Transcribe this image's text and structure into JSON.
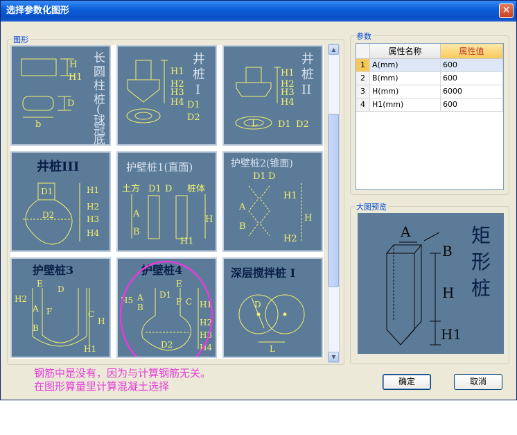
{
  "window": {
    "title": "选择参数化图形",
    "close": "✕"
  },
  "shapes_group": {
    "label": "图形"
  },
  "tiles": [
    {
      "name": "长圆柱桩(球冠底)",
      "lines": [
        "长",
        "圆",
        "柱",
        "桩",
        "(",
        "球",
        "冠",
        "底",
        ")"
      ],
      "labels": [
        "H",
        "H1",
        "D",
        "b"
      ]
    },
    {
      "name": "井桩I",
      "lines": [
        "井",
        "桩",
        "I"
      ],
      "labels": [
        "H1",
        "H2",
        "H3",
        "H4",
        "D1",
        "D2"
      ]
    },
    {
      "name": "井桩II",
      "lines": [
        "井",
        "桩",
        "II"
      ],
      "labels": [
        "H1",
        "H2",
        "H3",
        "H4",
        "L",
        "D1",
        "D2"
      ]
    },
    {
      "name": "井桩III",
      "title": "井桩III",
      "labels": [
        "D1",
        "D2",
        "H1",
        "H2",
        "H3",
        "H4"
      ]
    },
    {
      "name": "护壁桩1(直面)",
      "title": "护壁桩1(直面)",
      "labels": [
        "土方",
        "D1",
        "D",
        "桩体",
        "A",
        "B",
        "H",
        "H1"
      ]
    },
    {
      "name": "护壁桩2(锥面)",
      "title": "护壁桩2(锥面)",
      "labels": [
        "D1",
        "D",
        "A",
        "B",
        "H1",
        "H",
        "H2"
      ]
    },
    {
      "name": "护壁桩3",
      "title": "护壁桩3",
      "labels": [
        "E",
        "D",
        "H2",
        "A",
        "F",
        "B",
        "C",
        "H",
        "H1"
      ]
    },
    {
      "name": "护壁桩4",
      "title": "护壁桩4",
      "labels": [
        "E",
        "H5",
        "D1",
        "A",
        "B",
        "F",
        "C",
        "H1",
        "H2",
        "H3",
        "D2",
        "H4"
      ]
    },
    {
      "name": "深层搅拌桩 I",
      "title": "深层搅拌桩 I",
      "labels": [
        "D",
        "L"
      ]
    }
  ],
  "annotation": {
    "line1": "钢筋中是没有，因为与计算钢筋无关。",
    "line2": "在图形算量里计算混凝土选择"
  },
  "params_group": {
    "label": "参数"
  },
  "table": {
    "headers": [
      "属性名称",
      "属性值"
    ],
    "rows": [
      {
        "idx": "1",
        "name": "A(mm)",
        "value": "600"
      },
      {
        "idx": "2",
        "name": "B(mm)",
        "value": "600"
      },
      {
        "idx": "3",
        "name": "H(mm)",
        "value": "6000"
      },
      {
        "idx": "4",
        "name": "H1(mm)",
        "value": "600"
      }
    ]
  },
  "preview_group": {
    "label": "大图预览"
  },
  "preview": {
    "lines": [
      "矩",
      "形",
      "桩"
    ],
    "labels": [
      "A",
      "B",
      "H",
      "H1"
    ]
  },
  "buttons": {
    "ok": "确定",
    "cancel": "取消"
  },
  "colors": {
    "tile_bg": "#5b7b99",
    "drawing": "#f4f26a",
    "annotation": "#e43cd9",
    "highlight_circle": "#e43cd9"
  }
}
